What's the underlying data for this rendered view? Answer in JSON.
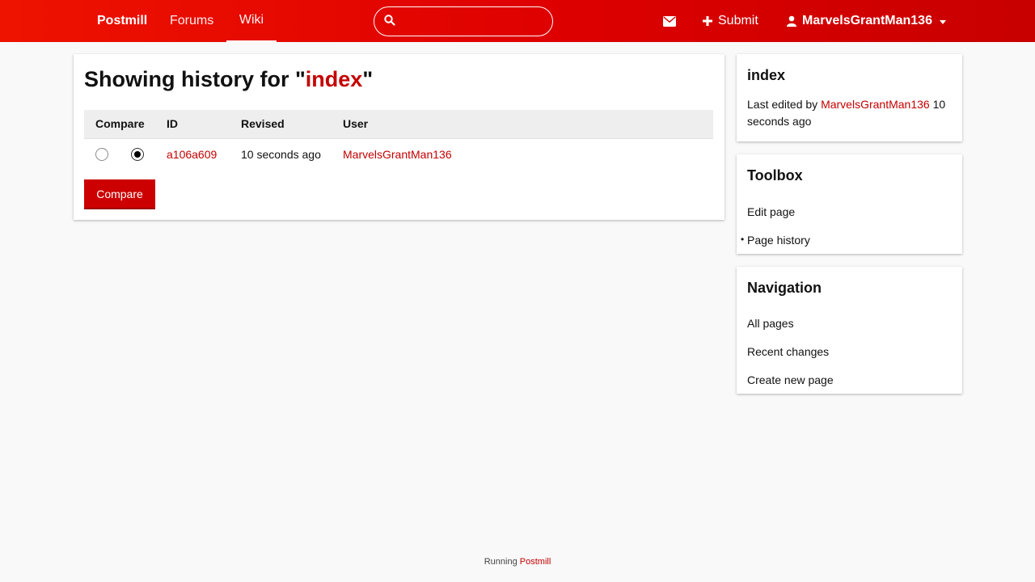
{
  "topbar": {
    "brand": "Postmill",
    "nav": [
      "Forums",
      "Wiki"
    ],
    "search": {
      "value": "",
      "placeholder": ""
    },
    "icons": {
      "search": "search-icon",
      "mail": "envelope-icon",
      "submit": "plus-icon",
      "user": "user-icon"
    },
    "submit_label": "Submit",
    "username": "MarvelsGrantMan136"
  },
  "main": {
    "title_prefix": "Showing history for \"",
    "title_page": "index",
    "title_suffix": "\"",
    "columns": [
      "Compare",
      "ID",
      "Revised",
      "User"
    ],
    "rows": [
      {
        "id": "a106a609",
        "revised": "10 seconds ago",
        "user": "MarvelsGrantMan136",
        "compare_from": false,
        "compare_to": true
      }
    ],
    "compare_button": "Compare"
  },
  "sidebar": {
    "page_box": {
      "title": "index",
      "edited_prefix": "Last edited by ",
      "edited_user": "MarvelsGrantMan136",
      "edited_time": " 10 seconds ago"
    },
    "toolbox": {
      "title": "Toolbox",
      "items": [
        "Edit page",
        "Page history"
      ]
    },
    "navigation": {
      "title": "Navigation",
      "items": [
        "All pages",
        "Recent changes",
        "Create new page"
      ]
    }
  },
  "footer": {
    "prefix": "Running ",
    "link": "Postmill"
  },
  "colors": {
    "accent": "#cc0000",
    "link": "#c40000",
    "background": "#f9f9f9"
  }
}
